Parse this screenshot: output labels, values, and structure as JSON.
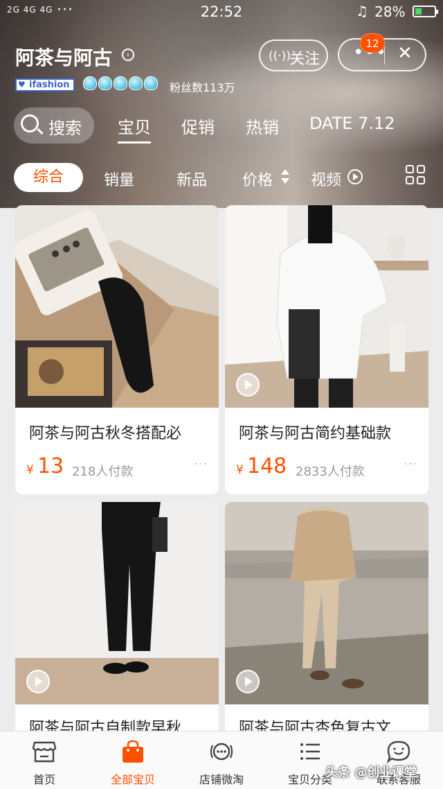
{
  "status_bar": {
    "signal": "2G 4G 4G",
    "time": "22:52",
    "battery": "28%",
    "battery_level": 0.28
  },
  "shop": {
    "name": "阿茶与阿古",
    "badge": "ifashion",
    "fans": "粉丝数113万",
    "follow_label": "关注",
    "notification_count": "12"
  },
  "nav": {
    "search_label": "搜索",
    "tabs": [
      "宝贝",
      "促销",
      "热销",
      "DATE 7.12"
    ],
    "active_tab": "宝贝"
  },
  "filters": {
    "items": [
      "综合",
      "销量",
      "新品",
      "价格",
      "视频"
    ],
    "active": "综合"
  },
  "products": [
    {
      "title": "阿茶与阿古秋冬搭配必",
      "price": "13",
      "currency": "¥",
      "sold": "218人付款",
      "has_video": false
    },
    {
      "title": "阿茶与阿古简约基础款",
      "price": "148",
      "currency": "¥",
      "sold": "2833人付款",
      "has_video": true
    },
    {
      "title": "阿茶与阿古自制款早秋",
      "price": "",
      "currency": "",
      "sold": "",
      "has_video": true
    },
    {
      "title": "阿茶与阿古杏色复古文",
      "price": "",
      "currency": "",
      "sold": "",
      "has_video": true
    }
  ],
  "tabbar": {
    "items": [
      "首页",
      "全部宝贝",
      "店铺微淘",
      "宝贝分类",
      "联系客服"
    ],
    "active": "全部宝贝"
  },
  "watermark": "头条 @创业课堂",
  "colors": {
    "accent": "#ff5000",
    "badge_blue": "#3b63c9"
  }
}
